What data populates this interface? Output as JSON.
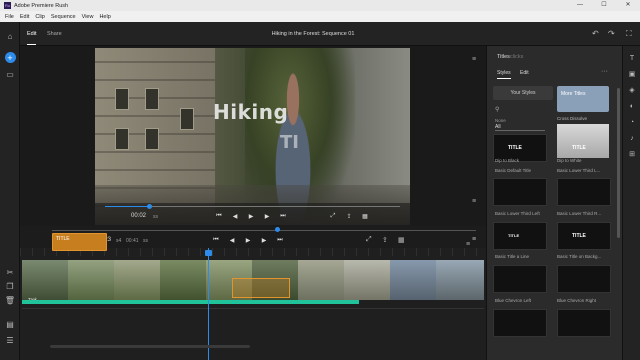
{
  "app": {
    "title": "Adobe Premiere Rush",
    "window_controls": [
      "—",
      "☐",
      "✕"
    ]
  },
  "menu": [
    "File",
    "Edit",
    "Clip",
    "Sequence",
    "View",
    "Help"
  ],
  "header": {
    "tabs": [
      "Edit",
      "Share"
    ],
    "project_title": "Hiking in the Forest: Sequence 01"
  },
  "video": {
    "title_line1": "Hiking",
    "title_line2": "TI"
  },
  "preview_timecode": "00:02",
  "preview_timecode_suffix": "ss",
  "main_timecode": "00:23",
  "main_timecode_frames": "s4",
  "main_duration": "00:41",
  "main_duration_frames": "ss",
  "timeline": {
    "title_clip_label": "TITLE",
    "clip_name": "Trek",
    "track_fill_fraction": 0.73
  },
  "right_panel": {
    "title": "Titles",
    "title_dim": "clicks",
    "tabs": [
      "Styles",
      "Edit"
    ],
    "styles_button": "Your Styles",
    "more_titles": "More Titles",
    "filter_label": "None",
    "filter_value": "All",
    "cross_dissolve": "Cross Dissolve",
    "cards": [
      {
        "label": "TITLE",
        "name": "Dip to Black"
      },
      {
        "label": "TITLE",
        "name": "Dip to White"
      },
      {
        "label": "",
        "name": "Basic Default Title"
      },
      {
        "label": "",
        "name": "Basic Lower Third L..."
      },
      {
        "label": "",
        "name": "Basic Lower Third Left"
      },
      {
        "label": "",
        "name": "Basic Lower Third R..."
      },
      {
        "label": "TITLE",
        "name": "Basic Title a Line"
      },
      {
        "label": "TITLE",
        "name": "Basic Title on Backg..."
      },
      {
        "label": "",
        "name": "Blue Chevron Left"
      },
      {
        "label": "",
        "name": "Blue Chevron Right"
      },
      {
        "label": "",
        "name": ""
      },
      {
        "label": "",
        "name": ""
      }
    ]
  }
}
